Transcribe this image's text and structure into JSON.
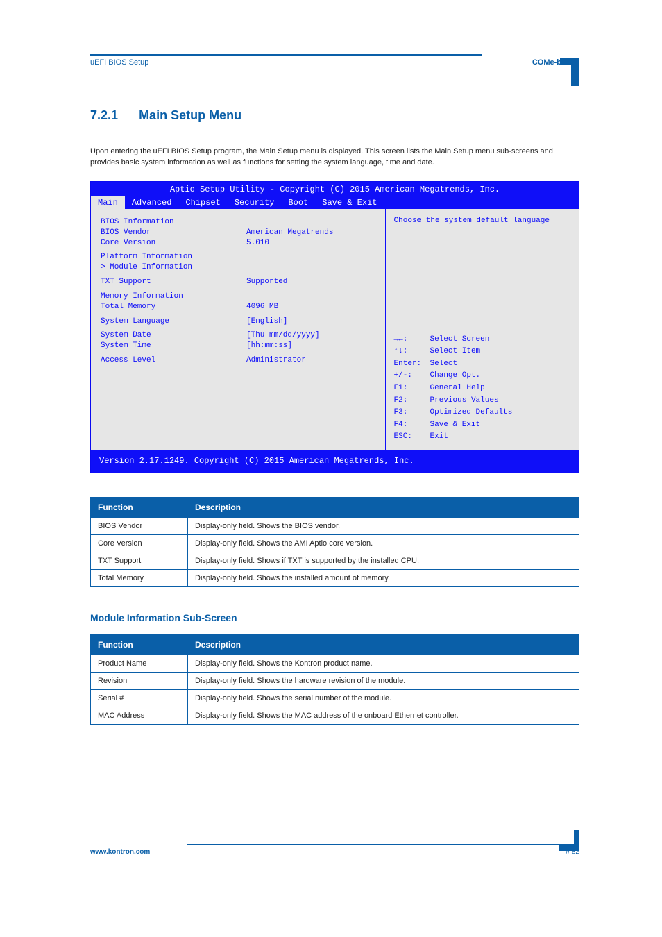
{
  "header": {
    "left": "uEFI BIOS Setup",
    "right": "COMe-bBD6"
  },
  "section": {
    "number": "7.2.1",
    "title": "Main Setup Menu"
  },
  "intro": "Upon entering the uEFI BIOS Setup program, the Main Setup menu is displayed. This screen lists the Main Setup menu sub-screens and provides basic system information as well as functions for setting the system language, time and date.",
  "bios": {
    "title": "Aptio Setup Utility - Copyright (C) 2015 American Megatrends, Inc.",
    "tabs": [
      "Main",
      "Advanced",
      "Chipset",
      "Security",
      "Boot",
      "Save & Exit"
    ],
    "active_tab": 0,
    "left_rows": [
      {
        "k": "BIOS Information",
        "v": ""
      },
      {
        "k": "BIOS Vendor",
        "v": "American Megatrends"
      },
      {
        "k": "Core Version",
        "v": "5.010"
      },
      {
        "k": "",
        "v": ""
      },
      {
        "k": "Platform Information",
        "v": ""
      },
      {
        "k": "> Module Information",
        "v": ""
      },
      {
        "k": "",
        "v": ""
      },
      {
        "k": "TXT Support",
        "v": "Supported"
      },
      {
        "k": "",
        "v": ""
      },
      {
        "k": "Memory Information",
        "v": ""
      },
      {
        "k": "Total Memory",
        "v": "4096 MB"
      },
      {
        "k": "",
        "v": ""
      },
      {
        "k": "System Language",
        "v": "[English]"
      },
      {
        "k": "",
        "v": ""
      },
      {
        "k": "System Date",
        "v": "[Thu mm/dd/yyyy]"
      },
      {
        "k": "System Time",
        "v": "[hh:mm:ss]"
      },
      {
        "k": "",
        "v": ""
      },
      {
        "k": "Access Level",
        "v": "Administrator"
      }
    ],
    "right_top": "Choose the system default language",
    "right_bottom": [
      {
        "k": "→←:",
        "v": "Select Screen"
      },
      {
        "k": "↑↓:",
        "v": "Select Item"
      },
      {
        "k": "Enter:",
        "v": "Select"
      },
      {
        "k": "+/-:",
        "v": "Change Opt."
      },
      {
        "k": "F1:",
        "v": "General Help"
      },
      {
        "k": "F2:",
        "v": "Previous Values"
      },
      {
        "k": "F3:",
        "v": "Optimized Defaults"
      },
      {
        "k": "F4:",
        "v": "Save & Exit"
      },
      {
        "k": "ESC:",
        "v": "Exit"
      }
    ],
    "footer": "Version 2.17.1249. Copyright (C) 2015 American Megatrends, Inc."
  },
  "table1": {
    "col1": "Function",
    "col2": "Description",
    "rows": [
      {
        "f": "BIOS Vendor",
        "d": "Display-only field. Shows the BIOS vendor."
      },
      {
        "f": "Core Version",
        "d": "Display-only field. Shows the AMI Aptio core version."
      },
      {
        "f": "TXT Support",
        "d": "Display-only field. Shows if TXT is supported by the installed CPU."
      },
      {
        "f": "Total Memory",
        "d": "Display-only field. Shows the installed amount of memory."
      }
    ]
  },
  "subheading": "Module Information Sub-Screen",
  "table2": {
    "col1": "Function",
    "col2": "Description",
    "rows": [
      {
        "f": "Product Name",
        "d": "Display-only field. Shows the Kontron product name."
      },
      {
        "f": "Revision",
        "d": "Display-only field. Shows the hardware revision of the module."
      },
      {
        "f": "Serial #",
        "d": "Display-only field. Shows the serial number of the module."
      },
      {
        "f": "MAC Address",
        "d": "Display-only field. Shows the MAC address of the onboard Ethernet controller."
      }
    ]
  },
  "footer": {
    "left": "www.kontron.com",
    "right": "// 82"
  }
}
